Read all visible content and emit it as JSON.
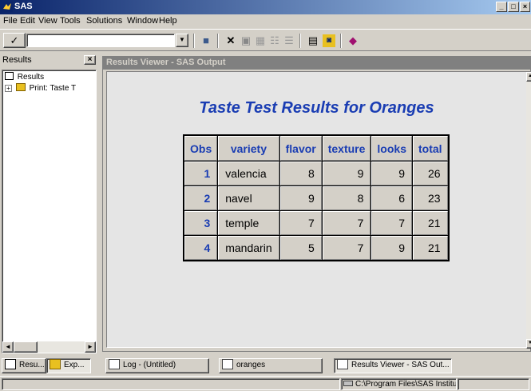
{
  "app": {
    "title": "SAS"
  },
  "menu": [
    "File",
    "Edit",
    "View",
    "Tools",
    "Solutions",
    "Window",
    "Help"
  ],
  "toolbar": {
    "command_value": ""
  },
  "results_pane": {
    "title": "Results",
    "tree": [
      {
        "label": "Results",
        "icon": "results-icon"
      },
      {
        "label": "Print:  Taste T",
        "icon": "print-folder-icon"
      }
    ]
  },
  "viewer": {
    "title": "Results Viewer - SAS Output",
    "report_title": "Taste Test Results for Oranges",
    "table": {
      "headers": [
        "Obs",
        "variety",
        "flavor",
        "texture",
        "looks",
        "total"
      ],
      "rows": [
        [
          "1",
          "valencia",
          "8",
          "9",
          "9",
          "26"
        ],
        [
          "2",
          "navel",
          "9",
          "8",
          "6",
          "23"
        ],
        [
          "3",
          "temple",
          "7",
          "7",
          "7",
          "21"
        ],
        [
          "4",
          "mandarin",
          "5",
          "7",
          "9",
          "21"
        ]
      ]
    }
  },
  "bottom_tabs": {
    "results": "Resu...",
    "explorer": "Exp..."
  },
  "taskbar": [
    "Log - (Untitled)",
    "oranges",
    "Results Viewer - SAS Out..."
  ],
  "statusbar": {
    "path": "C:\\Program Files\\SAS Institu"
  },
  "colors": {
    "title_blue": "#1a3db3",
    "titlebar_start": "#0a246a",
    "titlebar_end": "#a6caf0"
  }
}
